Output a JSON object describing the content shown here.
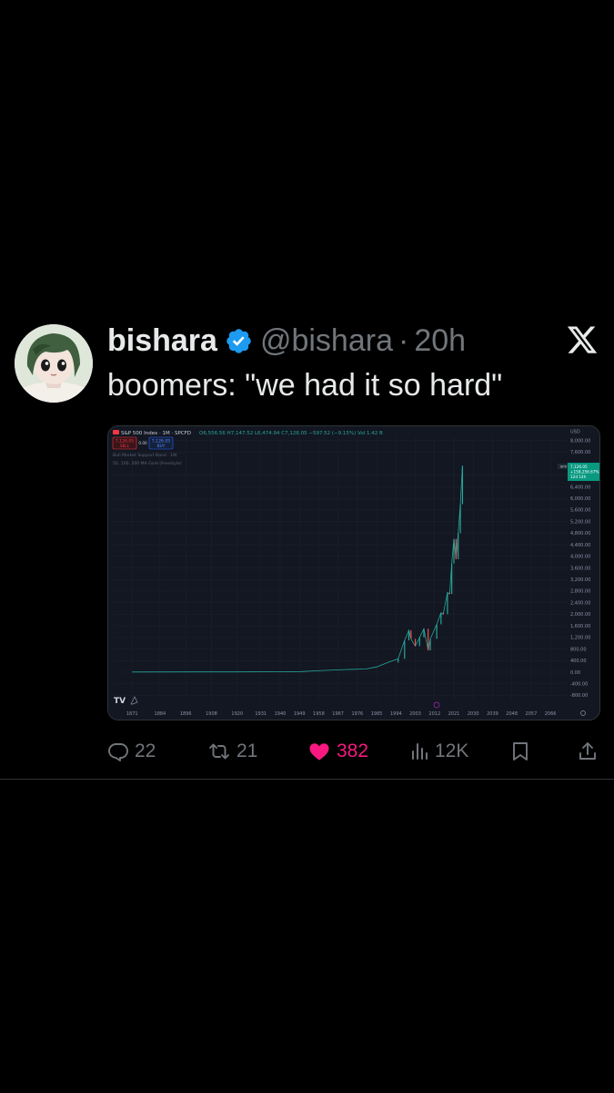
{
  "tweet": {
    "display_name": "bishara",
    "handle": "@bishara",
    "separator": "·",
    "time": "20h",
    "text": "boomers: \"we had it so hard\""
  },
  "actions": {
    "replies": "22",
    "reposts": "21",
    "likes": "382",
    "views": "12K"
  },
  "colors": {
    "background": "#000000",
    "like": "#f91880",
    "verified": "#1d9bf0",
    "muted": "#71767b"
  },
  "icons": [
    "x-logo-icon",
    "verified-badge-icon",
    "reply-icon",
    "repost-icon",
    "heart-icon",
    "views-icon",
    "bookmark-icon",
    "share-icon"
  ],
  "chart_screenshot": {
    "header": {
      "symbol": "S&P 500 Index · 1M · SPCFD",
      "ohlc": "O6,556.56  H7,147.52  L6,474.94  C7,126.05  −597.52 (−9.15%)  Vol 1.42 B",
      "sell_price": "7,126.05",
      "sell_label": "SELL",
      "spread": "0.00",
      "buy_price": "7,126.05",
      "buy_label": "BUY",
      "indicator_1": "Bull Market Support Band · 1W",
      "indicator_2": "50, 100, 200 MA Gold (Freestyle)"
    },
    "currency": "USD",
    "price_tag": {
      "symbol": "SPX",
      "price": "7,126.05",
      "change": "+158,256.67%",
      "time": "12d 14h"
    },
    "logo": "TV",
    "chart_data": {
      "type": "line",
      "title": "S&P 500 Index · 1M · SPCFD",
      "x_ticks": [
        "1871",
        "1884",
        "1896",
        "1908",
        "1920",
        "1931",
        "1940",
        "1949",
        "1958",
        "1967",
        "1976",
        "1985",
        "1994",
        "2003",
        "2012",
        "2021",
        "2030",
        "2039",
        "2048",
        "2057",
        "2066"
      ],
      "y_ticks": [
        "8,000.00",
        "7,600.00",
        "6,800.00",
        "6,400.00",
        "6,000.00",
        "5,600.00",
        "5,200.00",
        "4,800.00",
        "4,400.00",
        "4,000.00",
        "3,600.00",
        "3,200.00",
        "2,800.00",
        "2,400.00",
        "2,000.00",
        "1,600.00",
        "1,200.00",
        "800.00",
        "400.00",
        "0.00",
        "-400.00",
        "-800.00"
      ],
      "series": [
        {
          "x": [
            1871,
            1900,
            1920,
            1940,
            1950,
            1960,
            1970,
            1980,
            1985,
            1990,
            1995,
            1998,
            2000,
            2001,
            2003,
            2005,
            2007,
            2009,
            2010,
            2013,
            2015,
            2016,
            2018,
            2019,
            2020,
            2021,
            2022,
            2023,
            2024,
            2025
          ],
          "y": [
            5,
            8,
            10,
            15,
            20,
            60,
            90,
            110,
            180,
            330,
            460,
            1100,
            1450,
            1150,
            900,
            1200,
            1500,
            750,
            1150,
            1650,
            2050,
            2000,
            2750,
            2700,
            3750,
            4600,
            3900,
            4800,
            5800,
            7126
          ]
        }
      ],
      "ylim": [
        -800,
        8200
      ],
      "xlim": [
        1862,
        2074
      ]
    }
  }
}
